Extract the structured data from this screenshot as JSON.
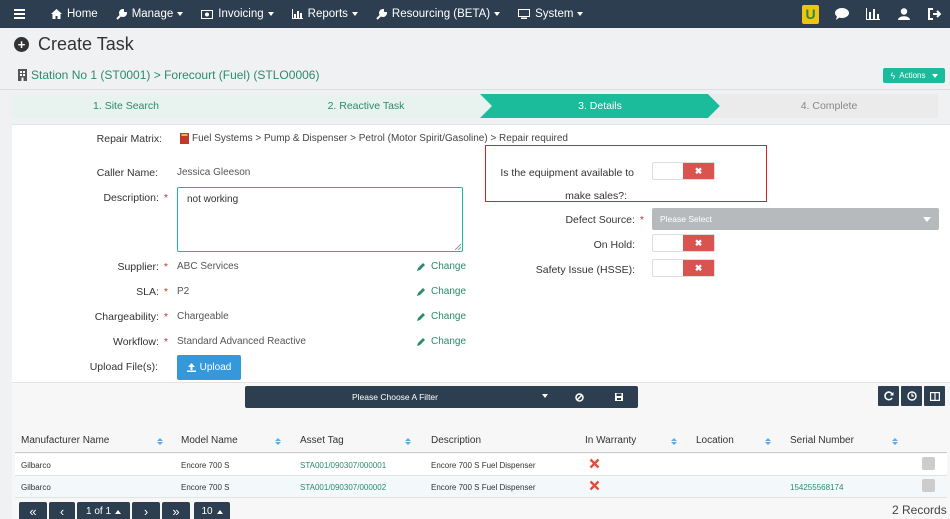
{
  "nav": {
    "home": "Home",
    "manage": "Manage",
    "invoicing": "Invoicing",
    "reports": "Reports",
    "resourcing": "Resourcing (BETA)",
    "system": "System",
    "brand_letter": "U"
  },
  "page": {
    "title": "Create Task",
    "breadcrumb": "Station No 1 (ST0001) > Forecourt (Fuel) (STLO0006)",
    "actions_label": "Actions"
  },
  "wizard": {
    "steps": [
      {
        "label": "1. Site Search",
        "state": "done"
      },
      {
        "label": "2. Reactive Task",
        "state": "done"
      },
      {
        "label": "3. Details",
        "state": "active"
      },
      {
        "label": "4. Complete",
        "state": "pending"
      }
    ]
  },
  "form": {
    "repair_matrix_label": "Repair Matrix:",
    "repair_matrix_value": "Fuel Systems > Pump & Dispenser > Petrol (Motor Spirit/Gasoline) > Repair required",
    "caller_label": "Caller Name:",
    "caller_value": "Jessica Gleeson",
    "description_label": "Description:",
    "description_value": "not working",
    "supplier_label": "Supplier:",
    "supplier_value": "ABC Services",
    "sla_label": "SLA:",
    "sla_value": "P2",
    "chargeability_label": "Chargeability:",
    "chargeability_value": "Chargeable",
    "workflow_label": "Workflow:",
    "workflow_value": "Standard Advanced Reactive",
    "change_label": "Change",
    "upload_label": "Upload File(s):",
    "upload_button": "Upload",
    "equipment_label_1": "Is the equipment available to",
    "equipment_label_2": "make sales?:",
    "defect_label": "Defect Source:",
    "defect_placeholder": "Please Select",
    "onhold_label": "On Hold:",
    "safety_label": "Safety Issue (HSSE):",
    "required_mark": "*"
  },
  "table": {
    "filter_placeholder": "Please Choose A Filter",
    "columns": [
      "Manufacturer Name",
      "Model Name",
      "Asset Tag",
      "Description",
      "In Warranty",
      "Location",
      "Serial Number"
    ],
    "rows": [
      {
        "manufacturer": "Gilbarco",
        "model": "Encore 700 S",
        "asset_tag": "STA001/090307/000001",
        "description": "Encore 700 S Fuel Dispenser",
        "in_warranty": false,
        "location": "",
        "serial": ""
      },
      {
        "manufacturer": "Gilbarco",
        "model": "Encore 700 S",
        "asset_tag": "STA001/090307/000002",
        "description": "Encore 700 S Fuel Dispenser",
        "in_warranty": false,
        "location": "",
        "serial": "154255568174"
      }
    ]
  },
  "pager": {
    "page_info": "1 of 1",
    "page_size": "10",
    "records": "2 Records"
  },
  "colors": {
    "nav_bg": "#2c3e50",
    "accent": "#1abc9c",
    "link": "#2a8c6c",
    "danger": "#d9534f",
    "upload": "#3498db"
  }
}
